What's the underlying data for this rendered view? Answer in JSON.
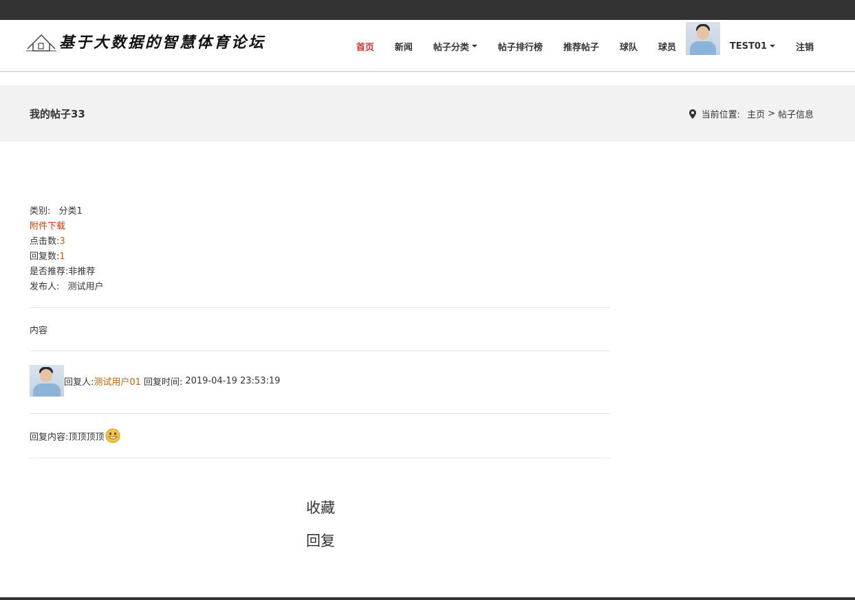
{
  "site": {
    "logo_text": "基于大数据的智慧体育论坛"
  },
  "nav": {
    "items": [
      {
        "label": "首页"
      },
      {
        "label": "新闻"
      },
      {
        "label": "帖子分类"
      },
      {
        "label": "帖子排行榜"
      },
      {
        "label": "推荐帖子"
      },
      {
        "label": "球队"
      },
      {
        "label": "球员"
      }
    ],
    "username": "TEST01",
    "logout": "注销",
    "active_color": "#d62e2e"
  },
  "banner": {
    "title": "我的帖子33",
    "location_label": "当前位置:",
    "crumb_home": "主页",
    "crumb_sep": ">",
    "crumb_current": "帖子信息"
  },
  "post": {
    "category_label": "类别:",
    "category_value": "分类1",
    "download_label": "附件下载",
    "clicks_label": "点击数:",
    "clicks_value": "3",
    "replies_label": "回复数:",
    "replies_value": "1",
    "recommended_label": "是否推荐:",
    "recommended_value": "非推荐",
    "author_label": "发布人:",
    "author_value": "测试用户",
    "body": "内容"
  },
  "reply": {
    "replier_label": "回复人:",
    "replier_name": "测试用户01",
    "time_label": "回复时间:",
    "time_value": "2019-04-19 23:53:19",
    "content_label": "回复内容:",
    "content_text": "顶顶顶顶"
  },
  "actions": {
    "favorite": "收藏",
    "reply": "回复"
  }
}
